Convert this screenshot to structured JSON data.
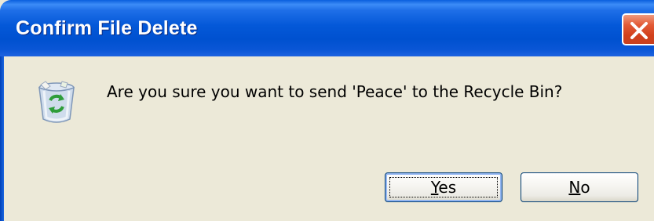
{
  "dialog": {
    "title": "Confirm File Delete",
    "message": "Are you sure you want to send 'Peace' to the Recycle Bin?",
    "icon": "recycle-bin-icon",
    "close_icon": "close-icon"
  },
  "buttons": {
    "yes": {
      "mnemonic": "Y",
      "rest": "es"
    },
    "no": {
      "mnemonic": "N",
      "rest": "o"
    }
  },
  "colors": {
    "titlebar": "#0058d8",
    "dialog_bg": "#ece9d8",
    "close_button": "#d2401c",
    "button_border": "#003c74"
  }
}
